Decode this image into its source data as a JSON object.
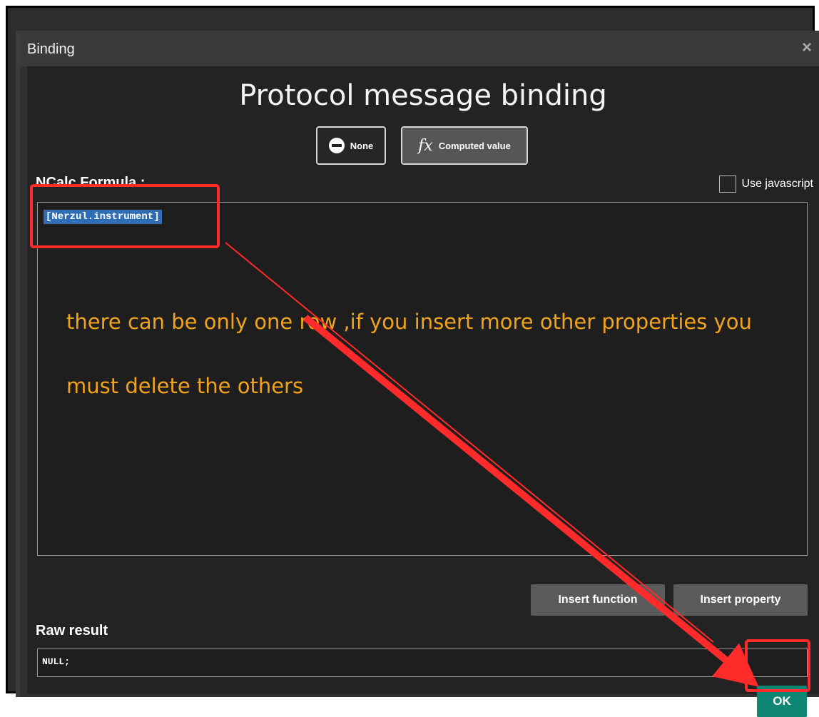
{
  "window": {
    "title": "Binding",
    "close_glyph": "×"
  },
  "dialog": {
    "heading": "Protocol message binding",
    "modes": [
      {
        "label": "None",
        "icon": "no-entry-icon"
      },
      {
        "label": "Computed value",
        "icon": "fx-icon",
        "glyph": "fx",
        "selected": true
      }
    ],
    "formula_label": "NCalc Formula :",
    "use_javascript_label": "Use javascript",
    "use_javascript_checked": false,
    "formula_value": "[Nerzul.instrument]",
    "insert_function_label": "Insert function",
    "insert_property_label": "Insert property",
    "raw_result_label": "Raw result",
    "raw_result_value": "NULL;",
    "ok_label": "OK"
  },
  "annotation": {
    "line1": "there can be only one row ,if you insert more other properties you",
    "line2": "must delete the others",
    "text_color": "#f0a31b",
    "highlight_color": "#ff2a2a"
  },
  "colors": {
    "accent": "#0f8573",
    "selection": "#2f6db5"
  }
}
